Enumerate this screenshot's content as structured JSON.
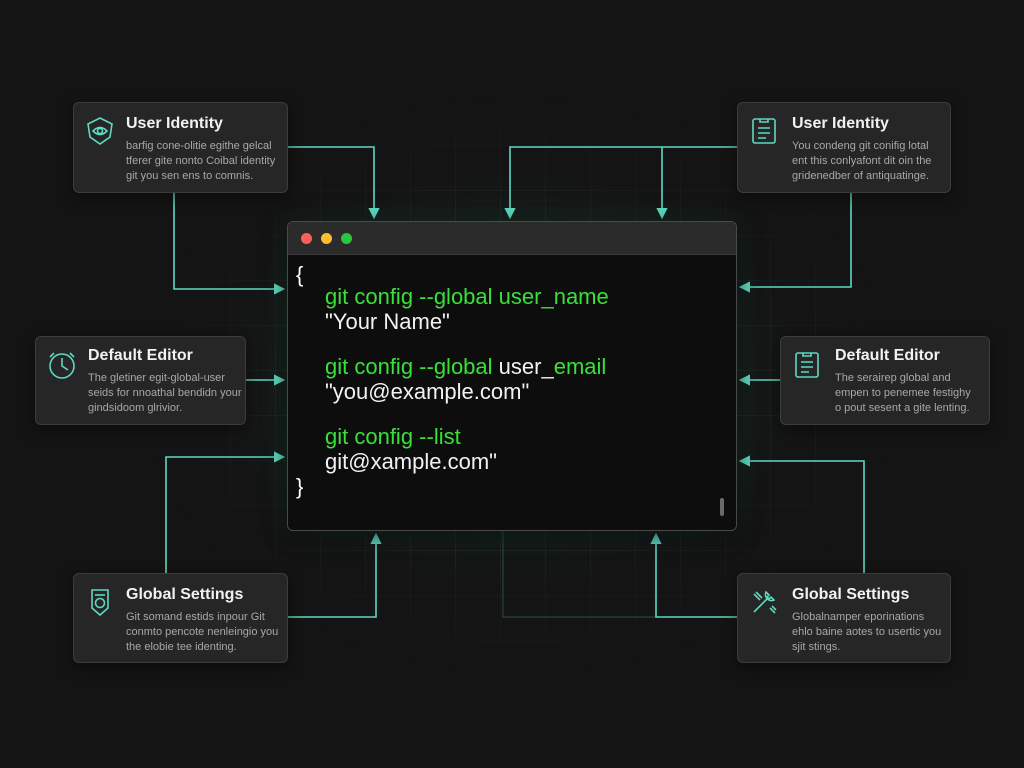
{
  "cards": {
    "tl": {
      "title": "User Identity",
      "lines": [
        "barfig cone-olitie egithe gelcal",
        "tferer gite nonto Coibal identity",
        "git you sen ens to comnis."
      ],
      "icon": "shield-eye-icon"
    },
    "tr": {
      "title": "User Identity",
      "lines": [
        "You condeng git conifig lotal",
        "ent this conlyafont dit oin the",
        "gridenedber of antiquatinge."
      ],
      "icon": "id-card-icon"
    },
    "ml": {
      "title": "Default Editor",
      "lines": [
        "The gletiner egit-global-user",
        "seids for nnoathal bendidn your",
        "gindsidoom glrivior."
      ],
      "icon": "clock-icon"
    },
    "mr": {
      "title": "Default Editor",
      "lines": [
        "The serairep global and",
        "empen to penemee festighy",
        "o pout sesent a gite lenting."
      ],
      "icon": "document-icon"
    },
    "bl": {
      "title": "Global Settings",
      "lines": [
        "Git somand estids inpour Git",
        "conmto pencote nenleingio you",
        "the elobie tee identing."
      ],
      "icon": "gear-shield-icon"
    },
    "br": {
      "title": "Global Settings",
      "lines": [
        "Globalnamper eporinations",
        "ehlo baine aotes to usertic you",
        "sjit stings."
      ],
      "icon": "tools-icon"
    }
  },
  "terminal": {
    "open_brace": "{",
    "close_brace": "}",
    "cmd1": "git config --global",
    "cmd1_key": "user_name",
    "val1": "\"Your Name\"",
    "cmd2": "git config --global",
    "cmd2_key_a": "user_",
    "cmd2_key_b": "email",
    "val2": "\"you@example.com\"",
    "cmd3": "git  config --list",
    "val3": "git@xample.com\""
  },
  "colors": {
    "background": "#141414",
    "connector": "#5fd8c0",
    "code_green": "#39e03a",
    "dot_red": "#ff5f57",
    "dot_yellow": "#febc2e",
    "dot_green": "#28c840"
  }
}
